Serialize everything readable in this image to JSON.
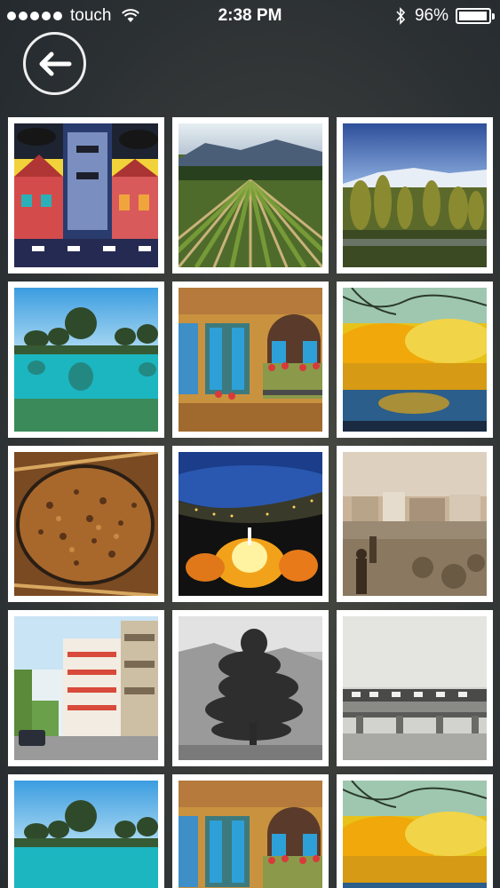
{
  "status_bar": {
    "carrier": "touch",
    "time": "2:38 PM",
    "battery": "96%",
    "battery_level": 0.96
  },
  "nav": {
    "back_icon": "back-arrow-icon"
  },
  "photos": [
    {
      "subject": "colorful-village-painting"
    },
    {
      "subject": "vineyard-rows"
    },
    {
      "subject": "snowy-mountains-poplars"
    },
    {
      "subject": "lake-trees-reflection"
    },
    {
      "subject": "old-house-blue-shutters"
    },
    {
      "subject": "autumn-trees-lake"
    },
    {
      "subject": "bread-on-tray"
    },
    {
      "subject": "bay-night-lights"
    },
    {
      "subject": "sepia-old-town"
    },
    {
      "subject": "apartment-building-street"
    },
    {
      "subject": "cedar-tree-bw"
    },
    {
      "subject": "old-bridge-sepia"
    },
    {
      "subject": "lake-trees-reflection"
    },
    {
      "subject": "old-house-blue-shutters"
    },
    {
      "subject": "autumn-trees-lake"
    }
  ]
}
